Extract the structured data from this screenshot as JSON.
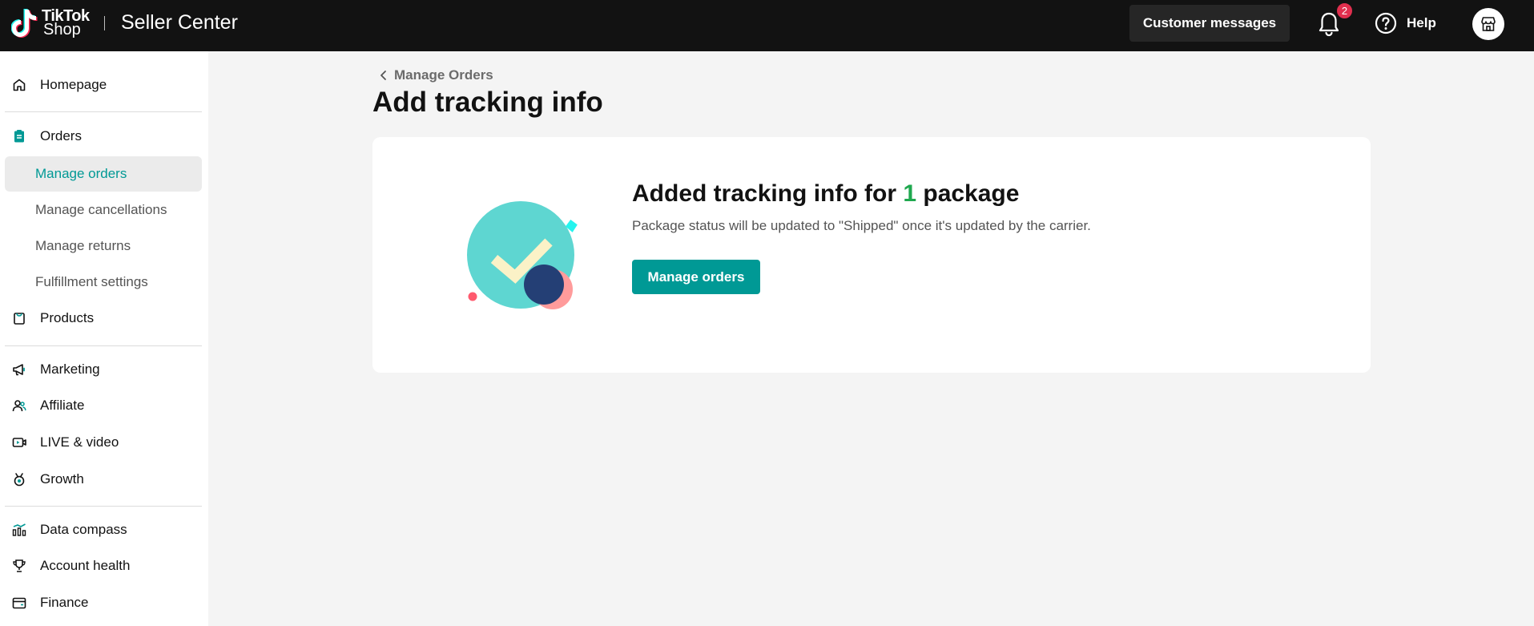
{
  "header": {
    "logo_line1": "TikTok",
    "logo_line2": "Shop",
    "product_name": "Seller Center",
    "customer_messages_label": "Customer messages",
    "notification_count": "2",
    "help_label": "Help"
  },
  "sidebar": {
    "items": [
      {
        "label": "Homepage",
        "icon": "home-icon"
      },
      {
        "label": "Orders",
        "icon": "orders-icon"
      },
      {
        "label": "Products",
        "icon": "products-icon"
      },
      {
        "label": "Marketing",
        "icon": "megaphone-icon"
      },
      {
        "label": "Affiliate",
        "icon": "users-icon"
      },
      {
        "label": "LIVE & video",
        "icon": "video-icon"
      },
      {
        "label": "Growth",
        "icon": "growth-icon"
      },
      {
        "label": "Data compass",
        "icon": "chart-icon"
      },
      {
        "label": "Account health",
        "icon": "trophy-icon"
      },
      {
        "label": "Finance",
        "icon": "wallet-icon"
      }
    ],
    "order_sub_items": [
      {
        "label": "Manage orders",
        "active": true
      },
      {
        "label": "Manage cancellations",
        "active": false
      },
      {
        "label": "Manage returns",
        "active": false
      },
      {
        "label": "Fulfillment settings",
        "active": false
      }
    ]
  },
  "main": {
    "breadcrumb": "Manage Orders",
    "title": "Add tracking info",
    "card": {
      "heading_prefix": "Added tracking info for ",
      "heading_count": "1",
      "heading_suffix": " package",
      "subtext": "Package status will be updated to \"Shipped\" once it's updated by the carrier.",
      "button_label": "Manage orders"
    }
  },
  "colors": {
    "accent": "#009995",
    "topbar": "#121212",
    "count_green": "#1fa84f",
    "badge_red": "#e02f4e"
  }
}
